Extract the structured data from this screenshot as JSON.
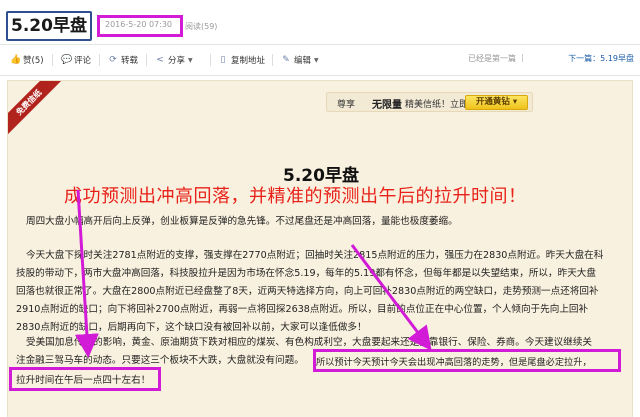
{
  "page": {
    "title": "5.20早盘",
    "date": "2016-5-20 07:30",
    "views": "阅读(59)"
  },
  "toolbar": {
    "like": "赞(5)",
    "comment": "评论",
    "repost": "转载",
    "share": "分享",
    "copy_url": "复制地址",
    "edit": "编辑"
  },
  "nav": {
    "first": "已经是第一篇",
    "next": "下一篇：5.19早盘"
  },
  "ribbon": "免费信纸",
  "promo": {
    "pre": "尊享",
    "strong": "无限量",
    "post": "精美信纸！立即",
    "button": "开通黄钻"
  },
  "article": {
    "heading": "5.20早盘",
    "annotation": "成功预测出冲高回落，并精准的预测出午后的拉升时间！",
    "para1": [
      "周四大盘小幅高开后向上反弹，创业板算是反弹的急先锋。不过尾盘还是冲高回落，量能也极度萎缩。"
    ],
    "para2": [
      "今天大盘下探时关注2781点附近的支撑，强支撑在2770点附近；回抽时关注2815点附近的压力，强压力在2830点附近。昨天大盘在科",
      "技股的带动下，两市大盘冲高回落，科技股拉升是因为市场在怀念5.19，每年的5.19都有怀念，但每年都是以失望结束，所以，昨天大盘",
      "回落也就很正常了。大盘在2800点附近已经盘整了8天，近两天特选择方向，向上可回补2830点附近的两空缺口，走势预测一点还将回补",
      "2910点附近的缺口；向下将回补2700点附近，再弱一点将回探2638点附近。所以，目前的点位正在中心位置，个人倾向于先向上回补",
      "2830点附近的缺口，后期再向下，这个缺口没有被回补以前，大家可以逢低做多！"
    ],
    "para3": [
      "受美国加息传闻的影响，黄金、原油期货下跌对相应的煤炭、有色构成利空，大盘要起来还是要靠银行、保险、券商。今天建议继续关",
      "注金融三驾马车的动态。只要这三个板块不大跌，大盘就没有问题。",
      "所以预计今天预计今天会出现冲高回落的走势，但是尾盘必定拉升，",
      "拉升时间在午后一点四十左右！"
    ]
  },
  "colors": {
    "highlight": "#d11bd6",
    "annotation": "#e8221a",
    "article_bg": "#f9f1df",
    "link": "#1d5fa8"
  }
}
